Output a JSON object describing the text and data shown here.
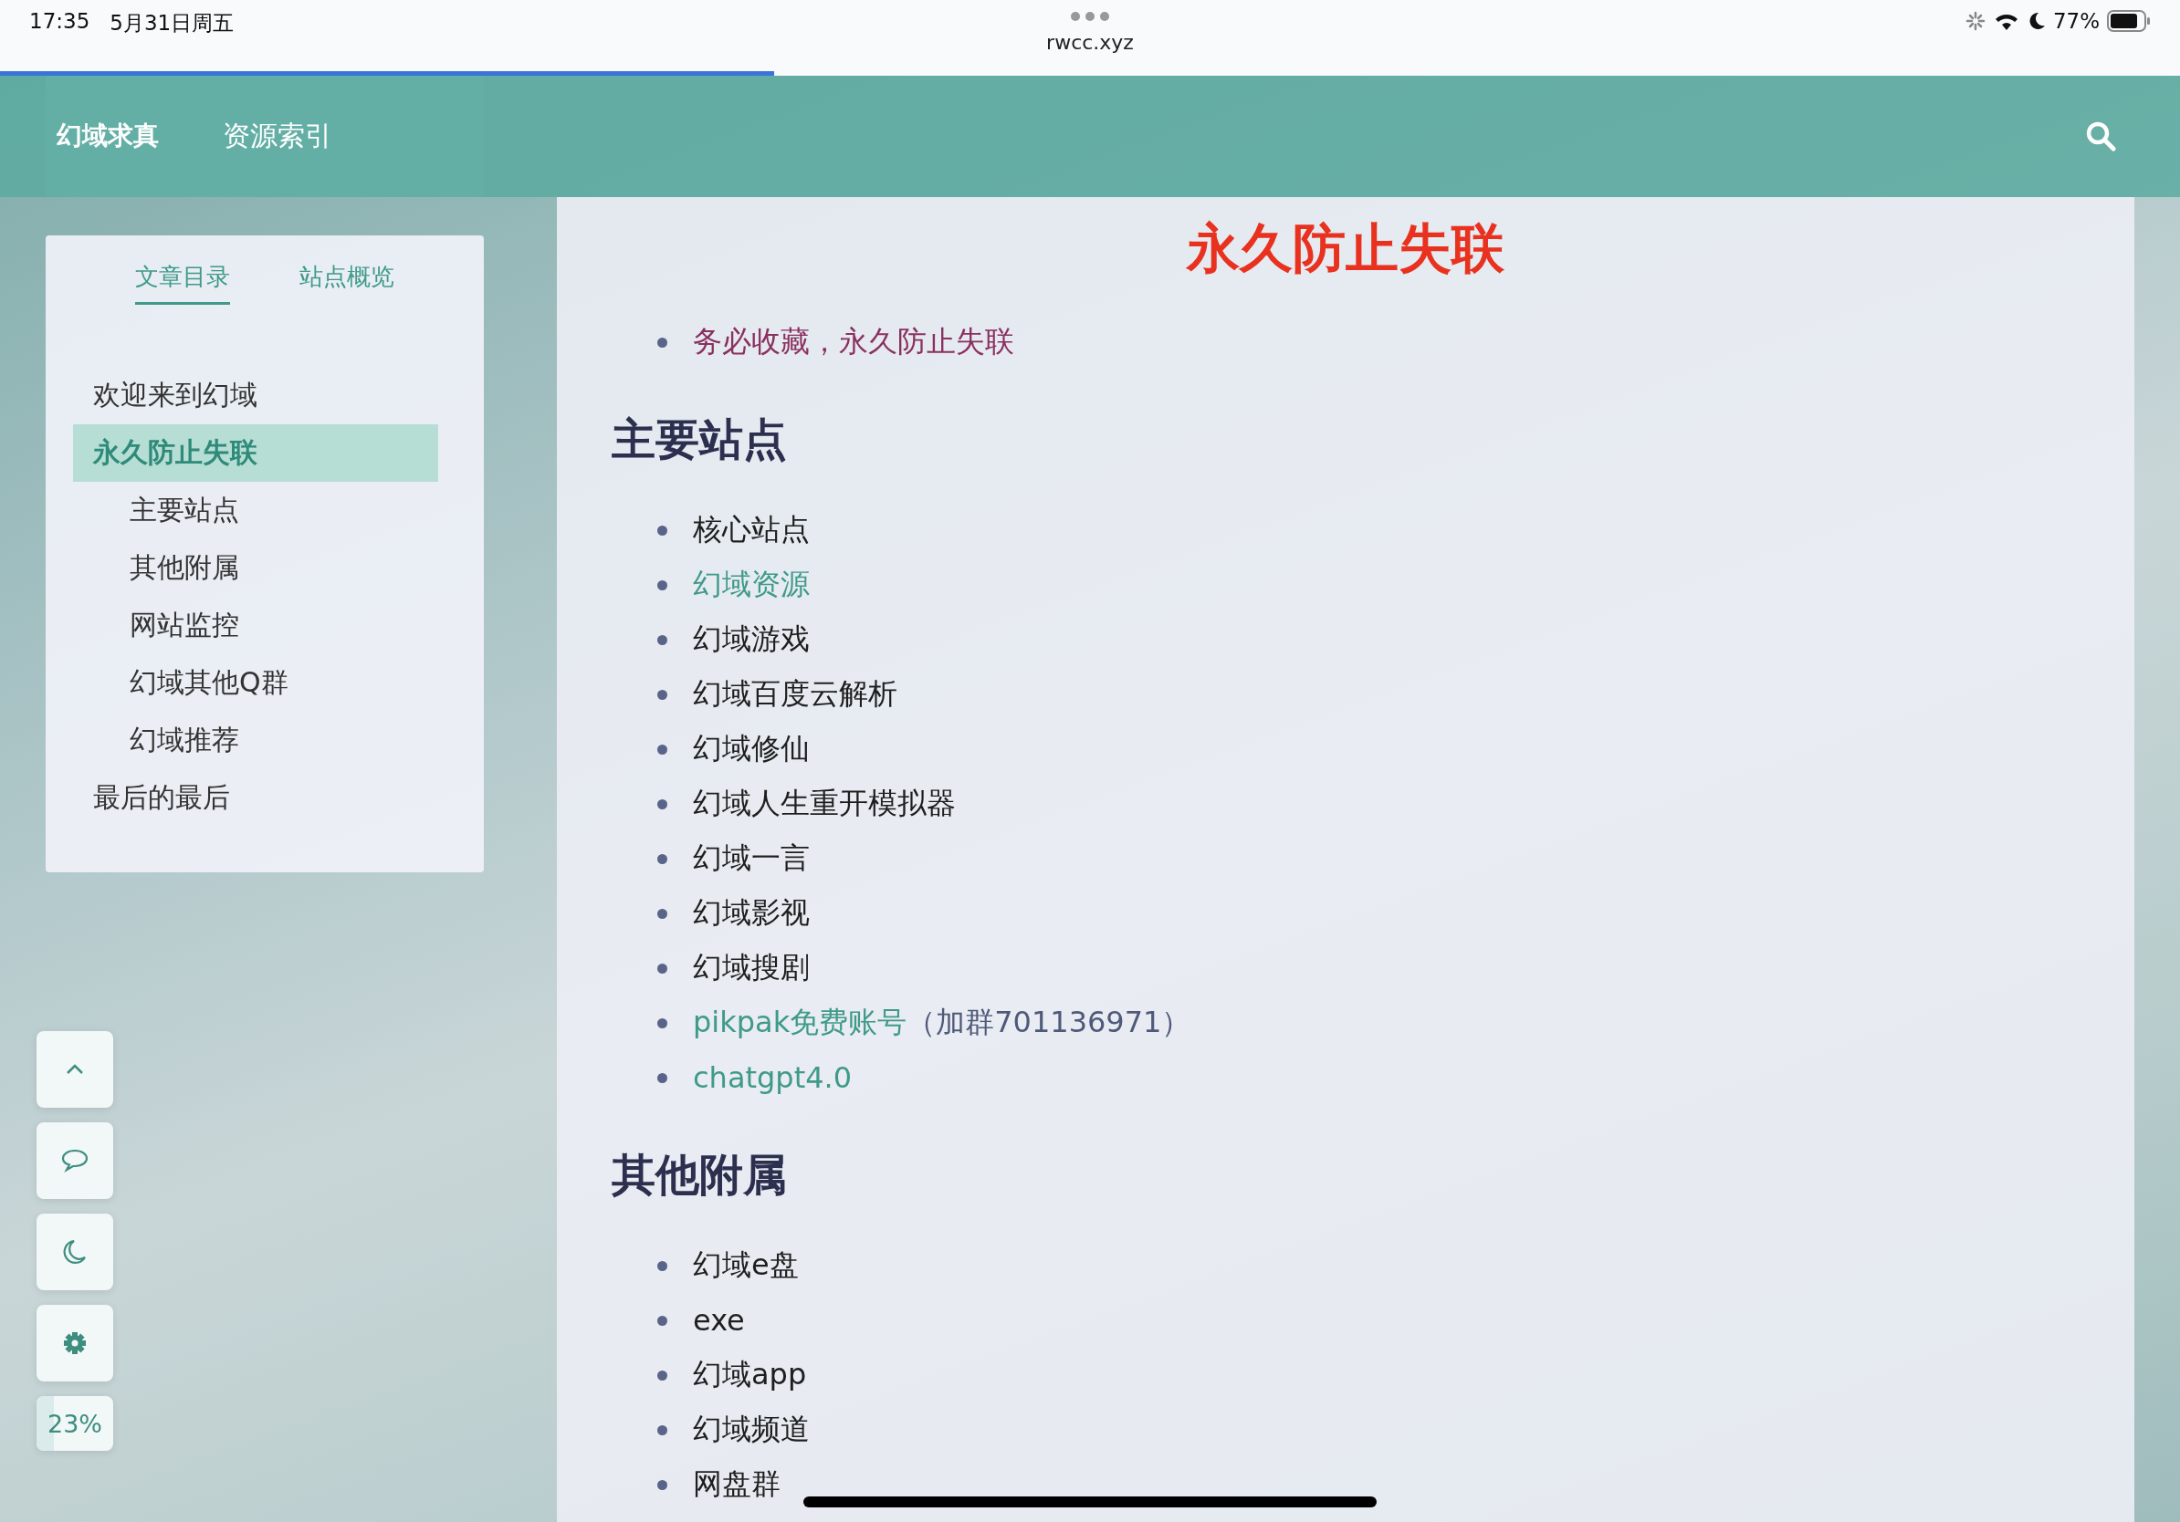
{
  "status_bar": {
    "time": "17:35",
    "date": "5月31日周五",
    "url": "rwcc.xyz",
    "battery": "77%"
  },
  "load_progress": {
    "level": 0.355
  },
  "header": {
    "brand": "幻域求真",
    "nav": "资源索引"
  },
  "sidebar": {
    "tabs": [
      {
        "label": "文章目录",
        "selected": true
      },
      {
        "label": "站点概览",
        "selected": false
      }
    ],
    "toc": [
      {
        "label": "欢迎来到幻域",
        "selected": false
      },
      {
        "label": "永久防止失联",
        "selected": true,
        "children": [
          {
            "label": "主要站点",
            "selected": false
          },
          {
            "label": "其他附属",
            "selected": false
          },
          {
            "label": "网站监控",
            "selected": false
          },
          {
            "label": "幻域其他Q群",
            "selected": false
          },
          {
            "label": "幻域推荐",
            "selected": false
          }
        ]
      },
      {
        "label": "最后的最后",
        "selected": false
      }
    ]
  },
  "float_buttons": [
    {
      "kind": "up"
    },
    {
      "kind": "comment"
    },
    {
      "kind": "dark-mode"
    },
    {
      "kind": "settings"
    },
    {
      "kind": "progress",
      "reading": "23%",
      "level": 0.23
    }
  ],
  "article": {
    "title": "永久防止失联",
    "sections": [
      {
        "items": [
          {
            "text": "务必收藏，永久防止失联",
            "kind": "notice"
          }
        ]
      },
      {
        "heading": "主要站点",
        "items": [
          {
            "text": "核心站点",
            "kind": "plain"
          },
          {
            "text": "幻域资源",
            "kind": "link"
          },
          {
            "text": "幻域游戏",
            "kind": "plain"
          },
          {
            "text": "幻域百度云解析",
            "kind": "plain"
          },
          {
            "text": "幻域修仙",
            "kind": "plain"
          },
          {
            "text": "幻域人生重开模拟器",
            "kind": "plain"
          },
          {
            "text": "幻域一言",
            "kind": "plain"
          },
          {
            "text": "幻域影视",
            "kind": "plain"
          },
          {
            "text": "幻域搜剧",
            "kind": "plain"
          },
          {
            "text": "pikpak免费账号",
            "kind": "link",
            "note": "（加群701136971）"
          },
          {
            "text": "chatgpt4.0",
            "kind": "link"
          }
        ]
      },
      {
        "heading": "其他附属",
        "items": [
          {
            "text": "幻域e盘",
            "kind": "plain"
          },
          {
            "text": "exe",
            "kind": "plain"
          },
          {
            "text": "幻域app",
            "kind": "plain"
          },
          {
            "text": "幻域频道",
            "kind": "plain"
          },
          {
            "text": "网盘群",
            "kind": "plain"
          }
        ]
      }
    ]
  }
}
